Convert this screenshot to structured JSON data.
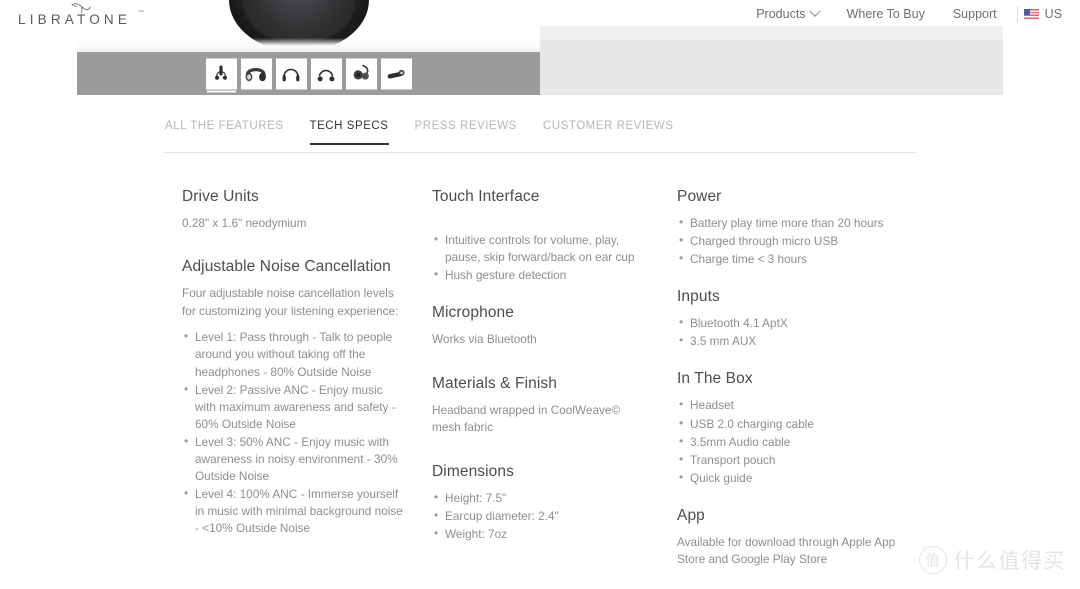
{
  "header": {
    "logo": {
      "text": "LIBRATONE",
      "trademark": "™",
      "bird_icon": "bird-icon"
    },
    "nav": [
      {
        "label": "Products",
        "has_dropdown": true
      },
      {
        "label": "Where To Buy",
        "has_dropdown": false
      },
      {
        "label": "Support",
        "has_dropdown": false
      }
    ],
    "locale": {
      "label": "US",
      "flag_icon": "us-flag-icon"
    }
  },
  "gallery": {
    "thumbnails": [
      {
        "name": "thumbnail-front-view",
        "selected": true
      },
      {
        "name": "thumbnail-angled-view",
        "selected": false
      },
      {
        "name": "thumbnail-outline-view",
        "selected": false
      },
      {
        "name": "thumbnail-earcup-view",
        "selected": false
      },
      {
        "name": "thumbnail-side-view",
        "selected": false
      },
      {
        "name": "thumbnail-folded-view",
        "selected": false
      }
    ]
  },
  "tabs": [
    {
      "label": "ALL THE FEATURES",
      "active": false
    },
    {
      "label": "TECH SPECS",
      "active": true
    },
    {
      "label": "PRESS REVIEWS",
      "active": false
    },
    {
      "label": "CUSTOMER REVIEWS",
      "active": false
    }
  ],
  "specs": {
    "column1": [
      {
        "heading": "Drive Units",
        "paragraph": "0.28\" x 1.6\" neodymium",
        "items": []
      },
      {
        "heading": "Adjustable Noise Cancellation",
        "paragraph": "Four adjustable noise cancellation levels for customizing your  listening experience:",
        "items": [
          "Level 1: Pass through - Talk to people around you without taking off the headphones - 80% Outside Noise",
          "Level 2: Passive ANC - Enjoy music with maximum awareness and safety - 60% Outside Noise",
          "Level 3: 50% ANC - Enjoy music with awareness in noisy environment - 30% Outside Noise",
          "Level 4: 100% ANC - Immerse yourself in music with minimal background noise - <10% Outside Noise"
        ]
      }
    ],
    "column2": [
      {
        "heading": "Touch Interface",
        "paragraph": "",
        "items": [
          "Intuitive controls for volume, play, pause, skip forward/back on ear cup",
          "Hush gesture detection"
        ]
      },
      {
        "heading": "Microphone",
        "paragraph": "Works via Bluetooth",
        "items": []
      },
      {
        "heading": "Materials & Finish",
        "paragraph": "Headband wrapped in CoolWeave© mesh fabric",
        "items": []
      },
      {
        "heading": "Dimensions",
        "paragraph": "",
        "items": [
          "Height: 7.5\"",
          "Earcup diameter: 2.4\"",
          "Weight: 7oz"
        ]
      }
    ],
    "column3": [
      {
        "heading": "Power",
        "paragraph": "",
        "items": [
          "Battery play time more than 20 hours",
          "Charged through micro USB",
          "Charge time < 3 hours"
        ]
      },
      {
        "heading": "Inputs",
        "paragraph": "",
        "items": [
          "Bluetooth 4.1 AptX",
          "3.5 mm AUX"
        ]
      },
      {
        "heading": "In The Box",
        "paragraph": "",
        "items": [
          "Headset",
          "USB 2.0 charging cable",
          "3.5mm Audio cable",
          "Transport pouch",
          "Quick guide"
        ]
      },
      {
        "heading": "App",
        "paragraph": "Available for download through Apple App Store and Google Play Store",
        "items": []
      }
    ]
  },
  "watermark": {
    "mark": "值",
    "text": "什么值得买"
  },
  "colors": {
    "thumb_strip_bg": "#9b9b9b",
    "panel_bg": "#e7e7e7",
    "active_tab": "#333333",
    "muted_text": "#8e8e8e"
  }
}
